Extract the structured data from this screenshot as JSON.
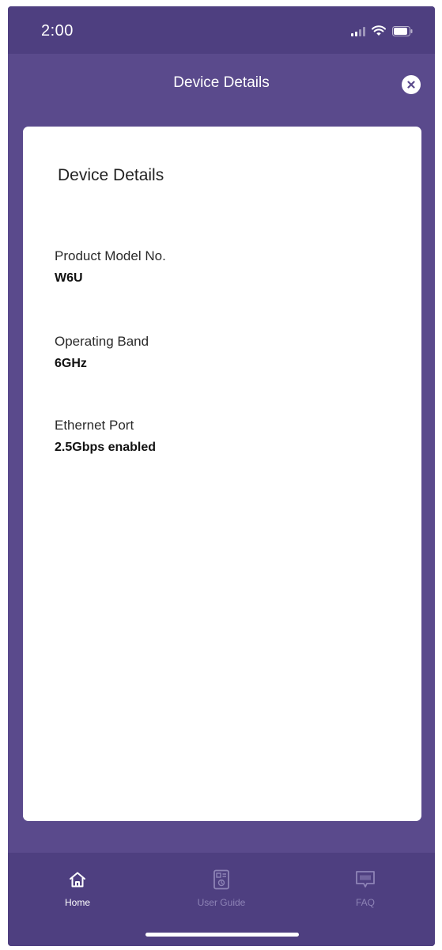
{
  "status_bar": {
    "time": "2:00"
  },
  "header": {
    "title": "Device Details"
  },
  "card": {
    "title": "Device Details",
    "fields": [
      {
        "label": "Product Model No.",
        "value": "W6U"
      },
      {
        "label": "Operating Band",
        "value": "6GHz"
      },
      {
        "label": "Ethernet Port",
        "value": "2.5Gbps enabled"
      }
    ]
  },
  "tab_bar": {
    "tabs": [
      {
        "label": "Home",
        "icon": "home-icon",
        "active": true
      },
      {
        "label": "User Guide",
        "icon": "user-guide-icon",
        "active": false
      },
      {
        "label": "FAQ",
        "icon": "faq-icon",
        "active": false
      }
    ]
  },
  "colors": {
    "background": "#5a4a8c",
    "bars": "#4e3f80",
    "card": "#ffffff",
    "inactive_tab": "#8e84b6"
  }
}
